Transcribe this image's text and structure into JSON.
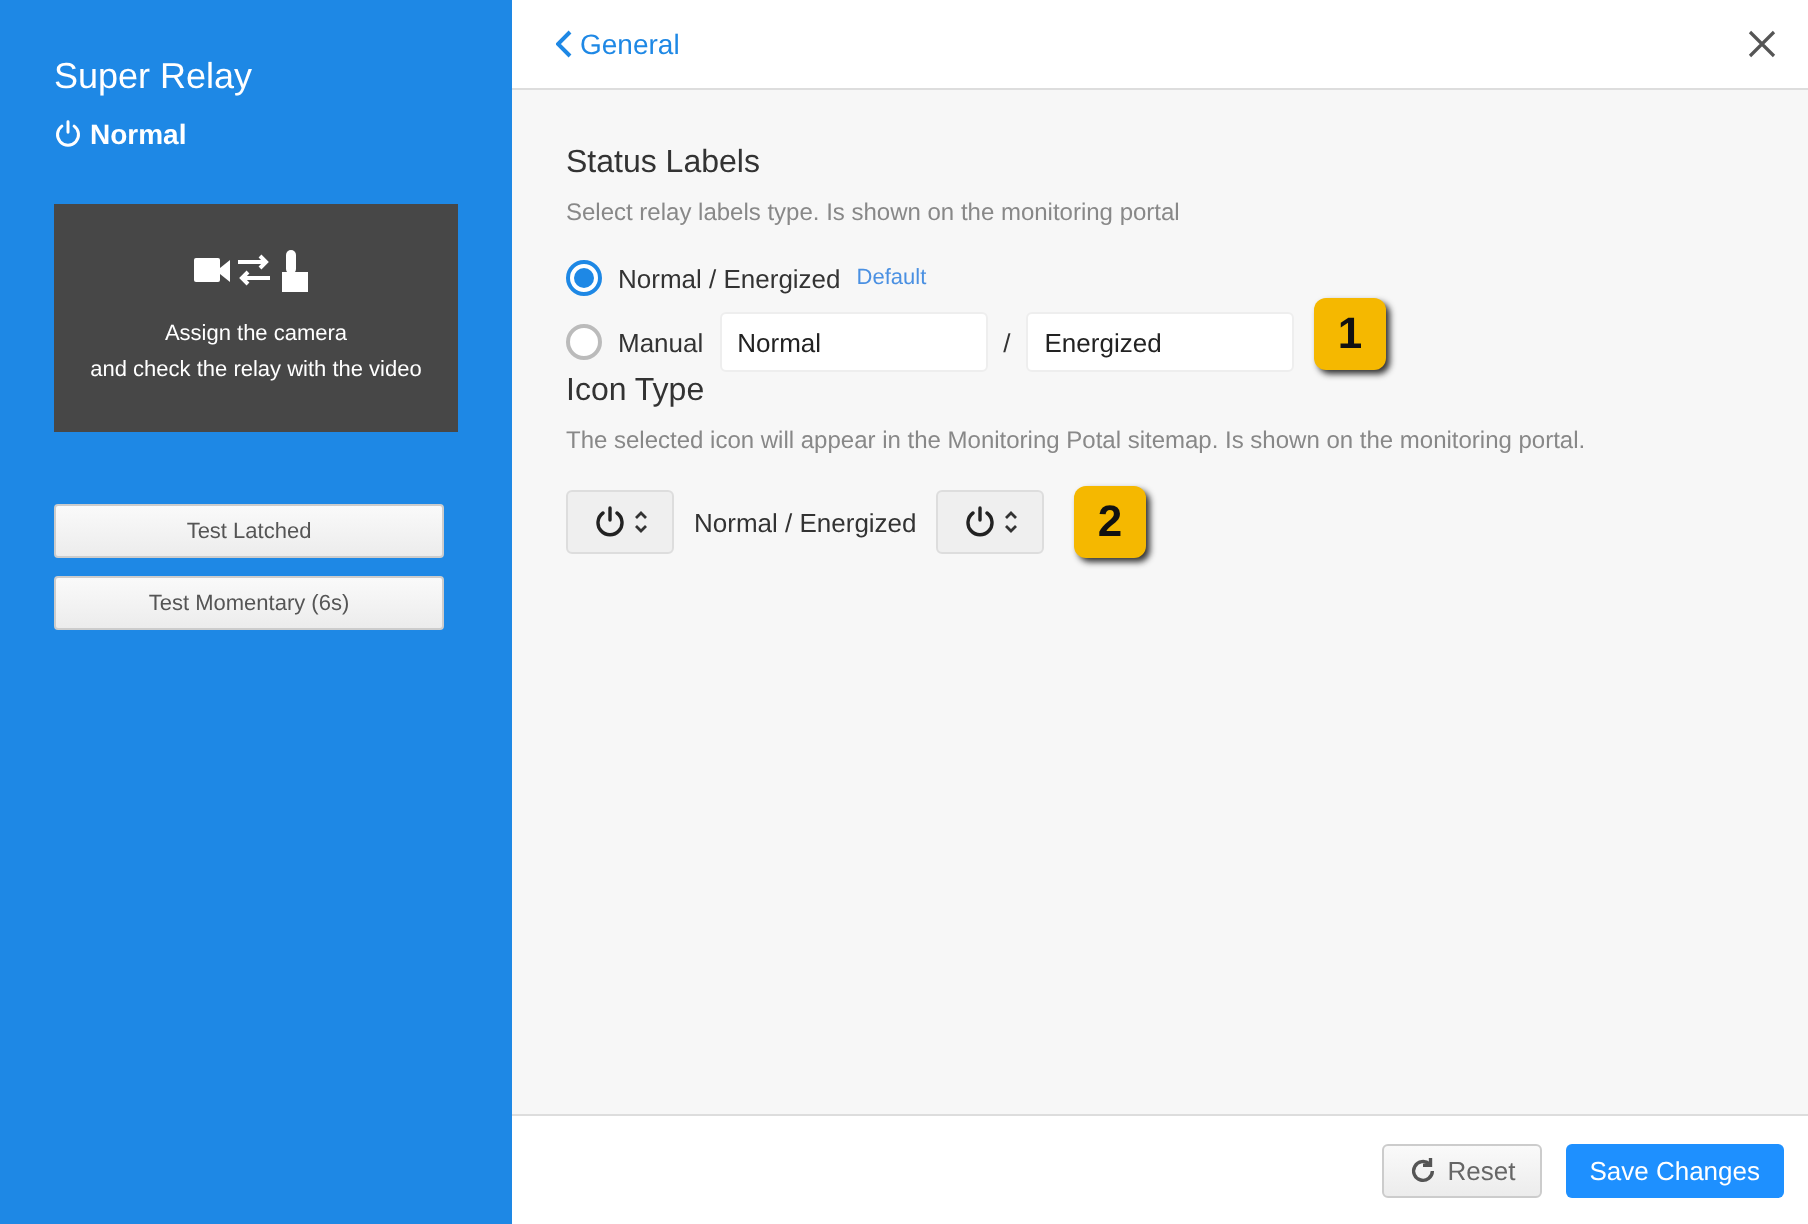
{
  "sidebar": {
    "title": "Super Relay",
    "state": "Normal",
    "camera_panel": {
      "lines": [
        "Assign the camera",
        "and check the relay with the video"
      ]
    },
    "buttons": [
      "Test Latched",
      "Test Momentary (6s)"
    ]
  },
  "header": {
    "back": "General"
  },
  "status_labels": {
    "title": "Status Labels",
    "description": "Select relay labels type. Is shown on the monitoring portal",
    "options": [
      {
        "kind": "plain",
        "label": "Normal / Energized",
        "tag": "Default",
        "selected": true
      },
      {
        "kind": "manual",
        "label": "Manual",
        "fields": [
          "Normal",
          "Energized"
        ],
        "separator": "/",
        "selected": false
      }
    ],
    "callout": "1"
  },
  "icon_type": {
    "title": "Icon Type",
    "description": "The selected icon will appear in the Monitoring Potal sitemap. Is shown on the monitoring portal.",
    "label": "Normal / Energized",
    "callout": "2"
  },
  "footer": {
    "buttons": [
      {
        "kind": "secondary",
        "label": "Reset"
      },
      {
        "kind": "primary",
        "label": "Save Changes"
      }
    ]
  }
}
